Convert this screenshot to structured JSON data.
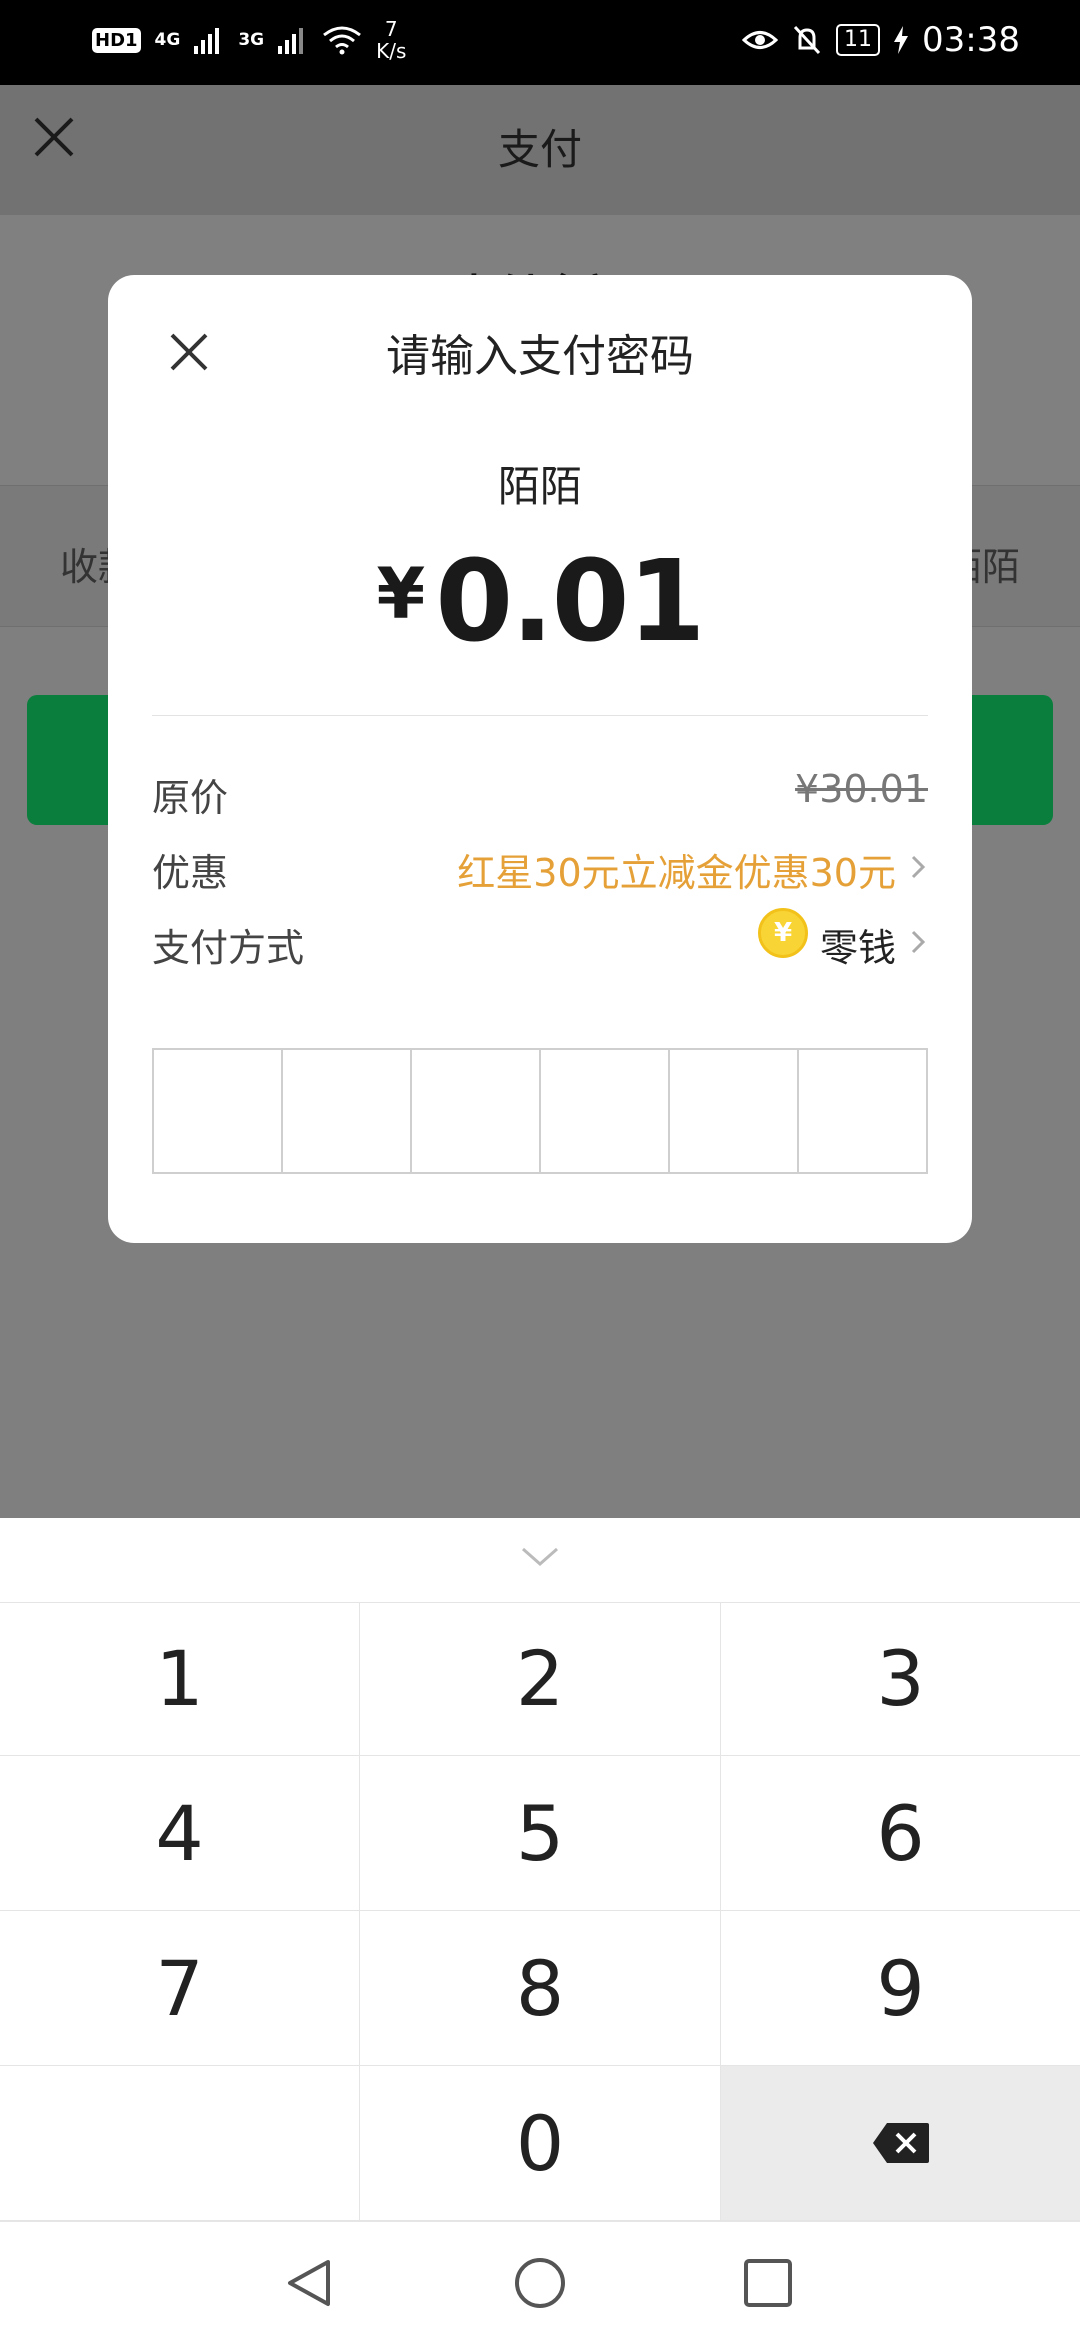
{
  "status_bar": {
    "hd": "HD",
    "hd_sim": "1",
    "net1": "4G",
    "net2": "3G",
    "speed_value": "7",
    "speed_unit": "K/s",
    "battery": "11",
    "time": "03:38"
  },
  "background_page": {
    "title": "支付",
    "amount_label": "支付金额",
    "row_left": "收款方",
    "row_right": "陌陌"
  },
  "dialog": {
    "title": "请输入支付密码",
    "payee": "陌陌",
    "currency": "¥",
    "amount": "0.01",
    "rows": [
      {
        "label": "原价",
        "value": "¥30.01"
      },
      {
        "label": "优惠",
        "value": "红星30元立减金优惠30元"
      },
      {
        "label": "支付方式",
        "value": "零钱"
      }
    ],
    "coin_symbol": "¥",
    "password_digits": 6
  },
  "keypad": {
    "keys": [
      "1",
      "2",
      "3",
      "4",
      "5",
      "6",
      "7",
      "8",
      "9",
      "",
      "0",
      "delete"
    ]
  },
  "colors": {
    "accent_green": "#0a7e3c",
    "promo_orange": "#e5a138",
    "coin_yellow": "#f9d435"
  }
}
